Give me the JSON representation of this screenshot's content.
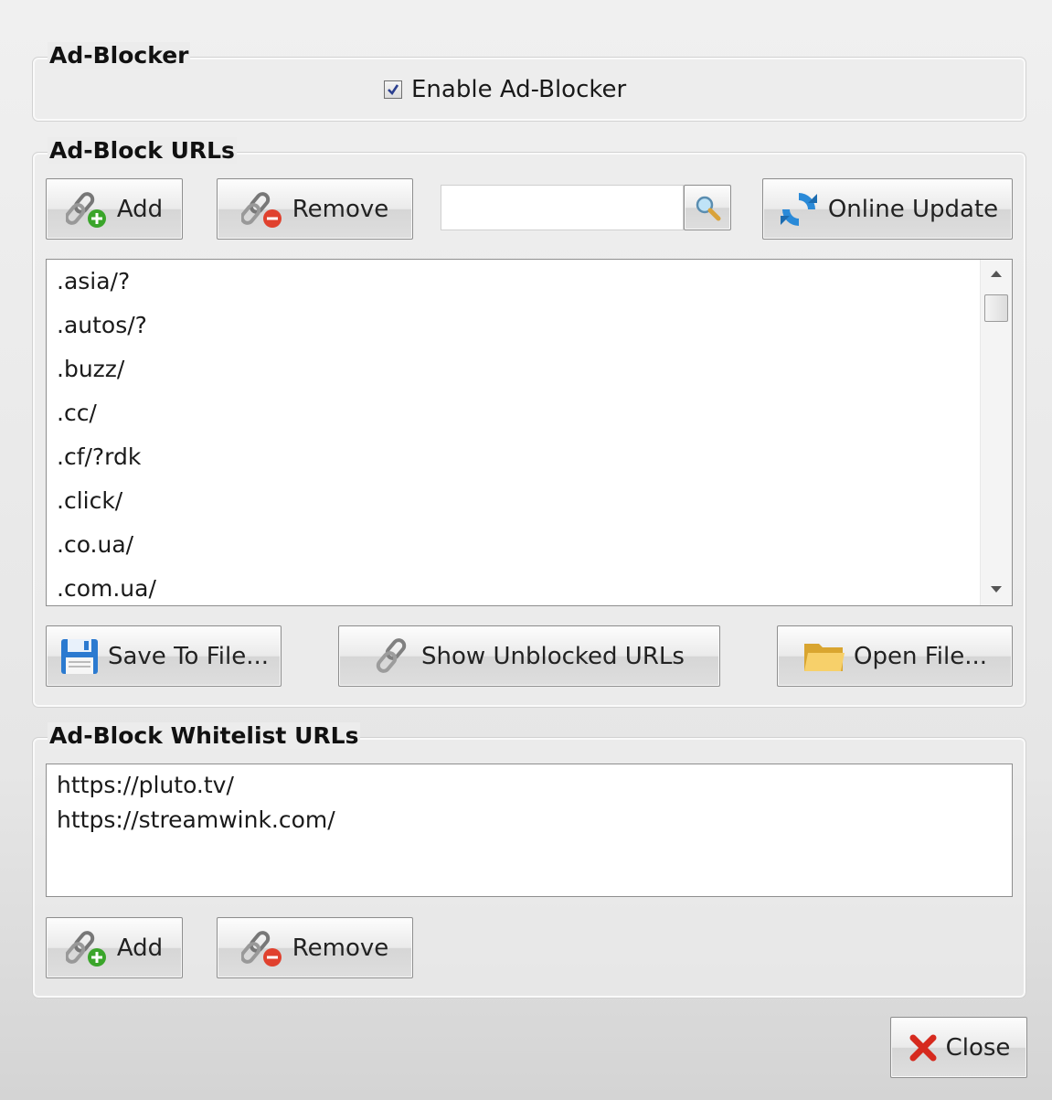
{
  "adblocker": {
    "legend": "Ad-Blocker",
    "enable_label": "Enable Ad-Blocker",
    "enabled": true
  },
  "urls": {
    "legend": "Ad-Block URLs",
    "add_label": "Add",
    "remove_label": "Remove",
    "search_value": "",
    "online_update_label": "Online Update",
    "items": [
      ".asia/?",
      ".autos/?",
      ".buzz/",
      ".cc/",
      ".cf/?rdk",
      ".click/",
      ".co.ua/",
      ".com.ua/"
    ],
    "save_label": "Save To File...",
    "show_unblocked_label": "Show Unblocked URLs",
    "open_label": "Open File..."
  },
  "whitelist": {
    "legend": "Ad-Block Whitelist URLs",
    "items": [
      "https://pluto.tv/",
      "https://streamwink.com/"
    ],
    "add_label": "Add",
    "remove_label": "Remove"
  },
  "close_label": "Close",
  "icons": {
    "add": "link-add-icon",
    "remove": "link-remove-icon",
    "search": "magnifier-icon",
    "update": "refresh-icon",
    "save": "floppy-disk-icon",
    "unblocked": "link-icon",
    "open": "folder-icon",
    "close": "red-x-icon"
  },
  "colors": {
    "add_badge": "#3aa52a",
    "remove_badge": "#e0412e",
    "update_icon": "#2a8ad8",
    "folder": "#f4c64a",
    "close_x": "#d62a1e",
    "checkbox_check": "#2b3f8f"
  }
}
